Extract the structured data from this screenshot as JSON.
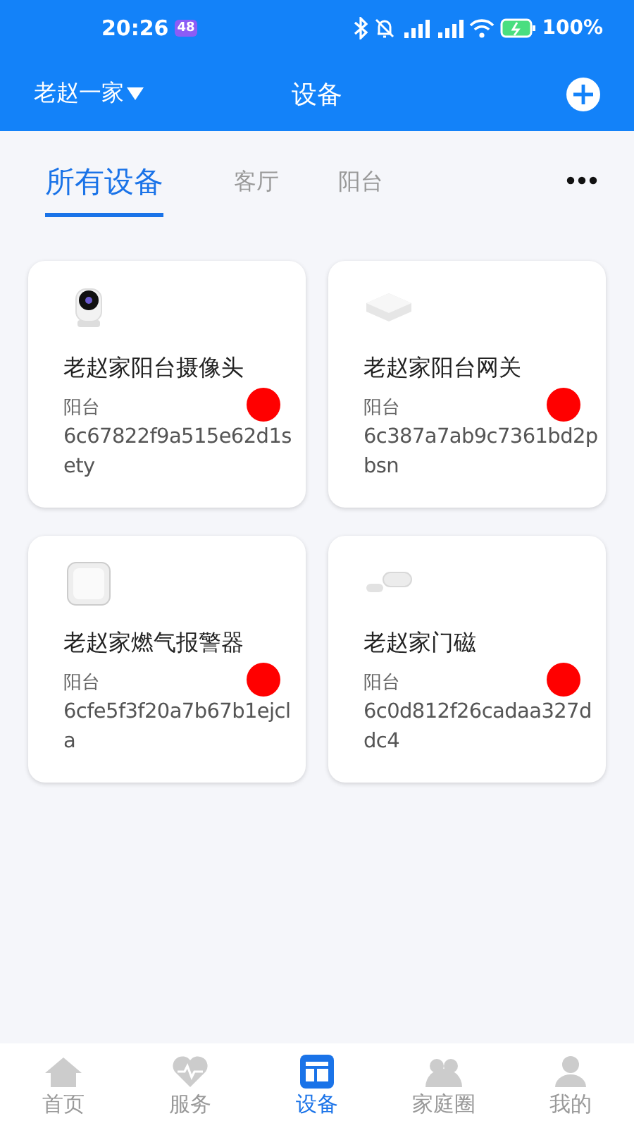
{
  "status_bar": {
    "time": "20:26",
    "badge": "48",
    "battery": "100%"
  },
  "header": {
    "home": "老赵一家",
    "title": "设备"
  },
  "tabs": [
    {
      "label": "所有设备",
      "selected": true
    },
    {
      "label": "客厅",
      "selected": false
    },
    {
      "label": "阳台",
      "selected": false
    }
  ],
  "devices": [
    {
      "kind": "camera",
      "name": "老赵家阳台摄像头",
      "room": "阳台",
      "id": "6c67822f9a515e62d1sety",
      "online": false
    },
    {
      "kind": "gateway",
      "name": "老赵家阳台网关",
      "room": "阳台",
      "id": "6c387a7ab9c7361bd2pbsn",
      "online": false
    },
    {
      "kind": "gas-alarm",
      "name": "老赵家燃气报警器",
      "room": "阳台",
      "id": "6cfe5f3f20a7b67b1ejcla",
      "online": false
    },
    {
      "kind": "door-sensor",
      "name": "老赵家门磁",
      "room": "阳台",
      "id": "6c0d812f26cadaa327ddc4",
      "online": false
    }
  ],
  "bottom_nav": [
    {
      "kind": "home",
      "label": "首页",
      "selected": false
    },
    {
      "kind": "service",
      "label": "服务",
      "selected": false
    },
    {
      "kind": "devices",
      "label": "设备",
      "selected": true
    },
    {
      "kind": "family",
      "label": "家庭圈",
      "selected": false
    },
    {
      "kind": "me",
      "label": "我的",
      "selected": false
    }
  ]
}
